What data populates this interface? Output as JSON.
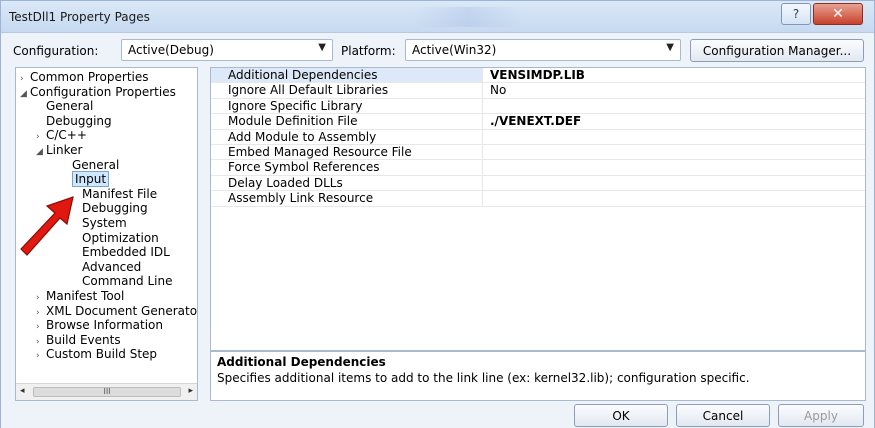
{
  "window": {
    "title": "TestDll1 Property Pages",
    "help_glyph": "?",
    "close_glyph": "✕"
  },
  "config": {
    "configuration_label": "Configuration:",
    "configuration_value": "Active(Debug)",
    "platform_label": "Platform:",
    "platform_value": "Active(Win32)",
    "manager_button": "Configuration Manager..."
  },
  "tree": {
    "items": [
      {
        "glyph": "›",
        "label": "Common Properties"
      },
      {
        "glyph": "◢",
        "label": "Configuration Properties"
      },
      {
        "glyph": "",
        "label": "General"
      },
      {
        "glyph": "",
        "label": "Debugging"
      },
      {
        "glyph": "›",
        "label": "C/C++"
      },
      {
        "glyph": "◢",
        "label": "Linker"
      },
      {
        "glyph": "",
        "label": "General"
      },
      {
        "glyph": "",
        "label": "Input"
      },
      {
        "glyph": "",
        "label": "Manifest File"
      },
      {
        "glyph": "",
        "label": "Debugging"
      },
      {
        "glyph": "",
        "label": "System"
      },
      {
        "glyph": "",
        "label": "Optimization"
      },
      {
        "glyph": "",
        "label": "Embedded IDL"
      },
      {
        "glyph": "",
        "label": "Advanced"
      },
      {
        "glyph": "",
        "label": "Command Line"
      },
      {
        "glyph": "›",
        "label": "Manifest Tool"
      },
      {
        "glyph": "›",
        "label": "XML Document Generator"
      },
      {
        "glyph": "›",
        "label": "Browse Information"
      },
      {
        "glyph": "›",
        "label": "Build Events"
      },
      {
        "glyph": "›",
        "label": "Custom Build Step"
      }
    ],
    "scroll_left": "◂",
    "scroll_right": "▸",
    "scroll_grip": "III"
  },
  "properties": [
    {
      "name": "Additional Dependencies",
      "value": "VENSIMDP.LIB"
    },
    {
      "name": "Ignore All Default Libraries",
      "value": "No"
    },
    {
      "name": "Ignore Specific Library",
      "value": ""
    },
    {
      "name": "Module Definition File",
      "value": "./VENEXT.DEF"
    },
    {
      "name": "Add Module to Assembly",
      "value": ""
    },
    {
      "name": "Embed Managed Resource File",
      "value": ""
    },
    {
      "name": "Force Symbol References",
      "value": ""
    },
    {
      "name": "Delay Loaded DLLs",
      "value": ""
    },
    {
      "name": "Assembly Link Resource",
      "value": ""
    }
  ],
  "description": {
    "title": "Additional Dependencies",
    "text": "Specifies additional items to add to the link line (ex: kernel32.lib); configuration specific."
  },
  "buttons": {
    "ok": "OK",
    "cancel": "Cancel",
    "apply": "Apply"
  },
  "colors": {
    "arrow_red": "#e0180f",
    "selection_blue": "#cde8ff"
  }
}
